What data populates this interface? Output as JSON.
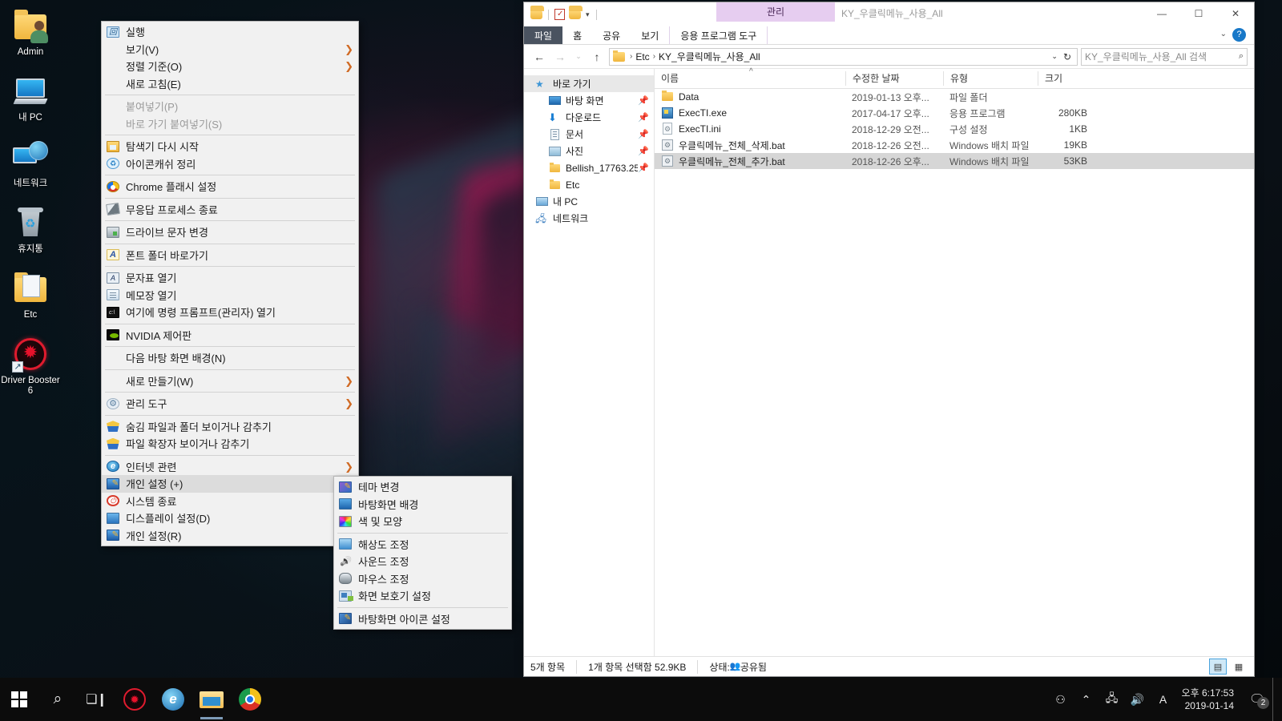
{
  "desktop": {
    "icons": [
      {
        "label": "Admin",
        "icon": "user-folder-icon"
      },
      {
        "label": "내 PC",
        "icon": "this-pc-icon"
      },
      {
        "label": "네트워크",
        "icon": "network-icon"
      },
      {
        "label": "휴지통",
        "icon": "recycle-bin-icon"
      },
      {
        "label": "Etc",
        "icon": "folder-icon"
      },
      {
        "label": "Driver Booster 6",
        "icon": "driver-booster-icon"
      }
    ]
  },
  "context_menu": {
    "items": [
      {
        "label": "실행",
        "icon": "run-icon",
        "arrow": false,
        "disabled": false,
        "selected": false,
        "sep_after": false
      },
      {
        "label": "보기(V)",
        "icon": "",
        "arrow": true,
        "disabled": false,
        "selected": false,
        "sep_after": false
      },
      {
        "label": "정렬 기준(O)",
        "icon": "",
        "arrow": true,
        "disabled": false,
        "selected": false,
        "sep_after": false
      },
      {
        "label": "새로 고침(E)",
        "icon": "",
        "arrow": false,
        "disabled": false,
        "selected": false,
        "sep_after": true
      },
      {
        "label": "붙여넣기(P)",
        "icon": "",
        "arrow": false,
        "disabled": true,
        "selected": false,
        "sep_after": false
      },
      {
        "label": "바로 가기 붙여넣기(S)",
        "icon": "",
        "arrow": false,
        "disabled": true,
        "selected": false,
        "sep_after": true
      },
      {
        "label": "탐색기 다시 시작",
        "icon": "explorer-restart-icon",
        "arrow": false,
        "disabled": false,
        "selected": false,
        "sep_after": false
      },
      {
        "label": "아이콘캐쉬 정리",
        "icon": "icon-cache-icon",
        "arrow": false,
        "disabled": false,
        "selected": false,
        "sep_after": true
      },
      {
        "label": "Chrome 플래시 설정",
        "icon": "chrome-icon",
        "arrow": false,
        "disabled": false,
        "selected": false,
        "sep_after": true
      },
      {
        "label": "무응답 프로세스 종료",
        "icon": "kill-process-icon",
        "arrow": false,
        "disabled": false,
        "selected": false,
        "sep_after": true
      },
      {
        "label": "드라이브 문자 변경",
        "icon": "drive-letter-icon",
        "arrow": false,
        "disabled": false,
        "selected": false,
        "sep_after": true
      },
      {
        "label": "폰트 폴더 바로가기",
        "icon": "font-folder-icon",
        "arrow": false,
        "disabled": false,
        "selected": false,
        "sep_after": true
      },
      {
        "label": "문자표 열기",
        "icon": "charmap-icon",
        "arrow": false,
        "disabled": false,
        "selected": false,
        "sep_after": false
      },
      {
        "label": "메모장 열기",
        "icon": "notepad-icon",
        "arrow": false,
        "disabled": false,
        "selected": false,
        "sep_after": false
      },
      {
        "label": "여기에 명령 프롬프트(관리자) 열기",
        "icon": "command-prompt-icon",
        "arrow": false,
        "disabled": false,
        "selected": false,
        "sep_after": true
      },
      {
        "label": "NVIDIA 제어판",
        "icon": "nvidia-icon",
        "arrow": false,
        "disabled": false,
        "selected": false,
        "sep_after": true
      },
      {
        "label": "다음 바탕 화면 배경(N)",
        "icon": "",
        "arrow": false,
        "disabled": false,
        "selected": false,
        "sep_after": true
      },
      {
        "label": "새로 만들기(W)",
        "icon": "",
        "arrow": true,
        "disabled": false,
        "selected": false,
        "sep_after": true
      },
      {
        "label": "관리 도구",
        "icon": "admin-tools-icon",
        "arrow": true,
        "disabled": false,
        "selected": false,
        "sep_after": true
      },
      {
        "label": "숨김 파일과 폴더 보이거나 감추기",
        "icon": "shield-icon",
        "arrow": false,
        "disabled": false,
        "selected": false,
        "sep_after": false
      },
      {
        "label": "파일 확장자 보이거나 감추기",
        "icon": "shield-icon",
        "arrow": false,
        "disabled": false,
        "selected": false,
        "sep_after": true
      },
      {
        "label": "인터넷 관련",
        "icon": "internet-explorer-icon",
        "arrow": true,
        "disabled": false,
        "selected": false,
        "sep_after": false
      },
      {
        "label": "개인 설정 (+)",
        "icon": "personalize-icon",
        "arrow": true,
        "disabled": false,
        "selected": true,
        "sep_after": false
      },
      {
        "label": "시스템 종료",
        "icon": "power-icon",
        "arrow": true,
        "disabled": false,
        "selected": false,
        "sep_after": false
      },
      {
        "label": "디스플레이 설정(D)",
        "icon": "display-settings-icon",
        "arrow": false,
        "disabled": false,
        "selected": false,
        "sep_after": false
      },
      {
        "label": "개인 설정(R)",
        "icon": "personalize-icon",
        "arrow": false,
        "disabled": false,
        "selected": false,
        "sep_after": false
      }
    ]
  },
  "sub_menu": {
    "items": [
      {
        "label": "테마 변경",
        "icon": "theme-icon",
        "sep_after": false
      },
      {
        "label": "바탕화면 배경",
        "icon": "wallpaper-icon",
        "sep_after": false
      },
      {
        "label": "색 및 모양",
        "icon": "color-appearance-icon",
        "sep_after": true
      },
      {
        "label": "해상도 조정",
        "icon": "resolution-icon",
        "sep_after": false
      },
      {
        "label": "사운드 조정",
        "icon": "sound-icon",
        "sep_after": false
      },
      {
        "label": "마우스 조정",
        "icon": "mouse-icon",
        "sep_after": false
      },
      {
        "label": "화면 보호기 설정",
        "icon": "screensaver-icon",
        "sep_after": true
      },
      {
        "label": "바탕화면 아이콘 설정",
        "icon": "desktop-icon-settings-icon",
        "sep_after": false
      }
    ]
  },
  "explorer": {
    "title": "KY_우클릭메뉴_사용_All",
    "contextual_tab_group": "관리",
    "tabs": [
      {
        "label": "파일",
        "kind": "file"
      },
      {
        "label": "홈",
        "kind": "normal"
      },
      {
        "label": "공유",
        "kind": "normal"
      },
      {
        "label": "보기",
        "kind": "normal"
      },
      {
        "label": "응용 프로그램 도구",
        "kind": "contextual"
      }
    ],
    "window_buttons": {
      "minimize": "—",
      "maximize": "☐",
      "close": "✕"
    },
    "ribbon_collapse": "⌄",
    "help": "?",
    "nav": {
      "back": "←",
      "forward": "→",
      "recent": "⌄",
      "up": "↑"
    },
    "breadcrumb": [
      "Etc",
      "KY_우클릭메뉴_사용_All"
    ],
    "address_dropdown": "⌄",
    "refresh": "↻",
    "search": {
      "placeholder": "KY_우클릭메뉴_사용_All 검색",
      "icon": "search-icon"
    },
    "nav_pane": [
      {
        "label": "바로 가기",
        "icon": "quick-access-icon",
        "level": 0,
        "header": true,
        "pinned": false
      },
      {
        "label": "바탕 화면",
        "icon": "desktop-icon",
        "level": 1,
        "header": false,
        "pinned": true
      },
      {
        "label": "다운로드",
        "icon": "downloads-icon",
        "level": 1,
        "header": false,
        "pinned": true
      },
      {
        "label": "문서",
        "icon": "documents-icon",
        "level": 1,
        "header": false,
        "pinned": true
      },
      {
        "label": "사진",
        "icon": "pictures-icon",
        "level": 1,
        "header": false,
        "pinned": true
      },
      {
        "label": "Bellish_17763.25",
        "icon": "folder-icon",
        "level": 1,
        "header": false,
        "pinned": true
      },
      {
        "label": "Etc",
        "icon": "folder-icon",
        "level": 1,
        "header": false,
        "pinned": false
      },
      {
        "label": "내 PC",
        "icon": "this-pc-icon",
        "level": 0,
        "header": false,
        "pinned": false
      },
      {
        "label": "네트워크",
        "icon": "network-icon",
        "level": 0,
        "header": false,
        "pinned": false
      }
    ],
    "columns": [
      "이름",
      "수정한 날짜",
      "유형",
      "크기"
    ],
    "sort_indicator": "^",
    "files": [
      {
        "name": "Data",
        "date": "2019-01-13 오후...",
        "type": "파일 폴더",
        "size": "",
        "icon": "folder-icon",
        "selected": false
      },
      {
        "name": "ExecTI.exe",
        "date": "2017-04-17 오후...",
        "type": "응용 프로그램",
        "size": "280KB",
        "icon": "exe-icon",
        "selected": false
      },
      {
        "name": "ExecTI.ini",
        "date": "2018-12-29 오전...",
        "type": "구성 설정",
        "size": "1KB",
        "icon": "ini-icon",
        "selected": false
      },
      {
        "name": "우클릭메뉴_전체_삭제.bat",
        "date": "2018-12-26 오전...",
        "type": "Windows 배치 파일",
        "size": "19KB",
        "icon": "bat-icon",
        "selected": false
      },
      {
        "name": "우클릭메뉴_전체_추가.bat",
        "date": "2018-12-26 오후...",
        "type": "Windows 배치 파일",
        "size": "53KB",
        "icon": "bat-icon",
        "selected": true
      }
    ],
    "status": {
      "item_count": "5개 항목",
      "selection": "1개 항목 선택함 52.9KB",
      "share_state": "상태:",
      "share_label": "공유됨"
    },
    "view_buttons": [
      {
        "name": "details-view-button",
        "glyph": "▤",
        "active": true
      },
      {
        "name": "large-icons-view-button",
        "glyph": "▦",
        "active": false
      }
    ]
  },
  "taskbar": {
    "start": "start-button",
    "buttons": [
      {
        "name": "search-button",
        "glyph": "⌕",
        "running": false
      },
      {
        "name": "task-view-button",
        "glyph": "❏",
        "running": false
      },
      {
        "name": "driver-booster-taskbar-button",
        "glyph": "✹",
        "running": false
      },
      {
        "name": "internet-explorer-taskbar-button",
        "glyph": "e",
        "running": false
      },
      {
        "name": "file-explorer-taskbar-button",
        "glyph": "▬",
        "running": true
      },
      {
        "name": "chrome-taskbar-button",
        "glyph": "◉",
        "running": false
      }
    ],
    "tray": {
      "people": "⚇",
      "chevron": "⌃",
      "network": "🖧",
      "volume": "🔊",
      "ime": "A",
      "time": "오후 6:17:53",
      "date": "2019-01-14",
      "notification_badge": "2"
    }
  },
  "colors": {
    "accent": "#1878c8",
    "contextual_tab": "#e6cdf0",
    "file_tab": "#4a5360",
    "menu_bg": "#f1f1f1",
    "selection": "#d6d6d6",
    "taskbar": "#0c0c0c"
  }
}
